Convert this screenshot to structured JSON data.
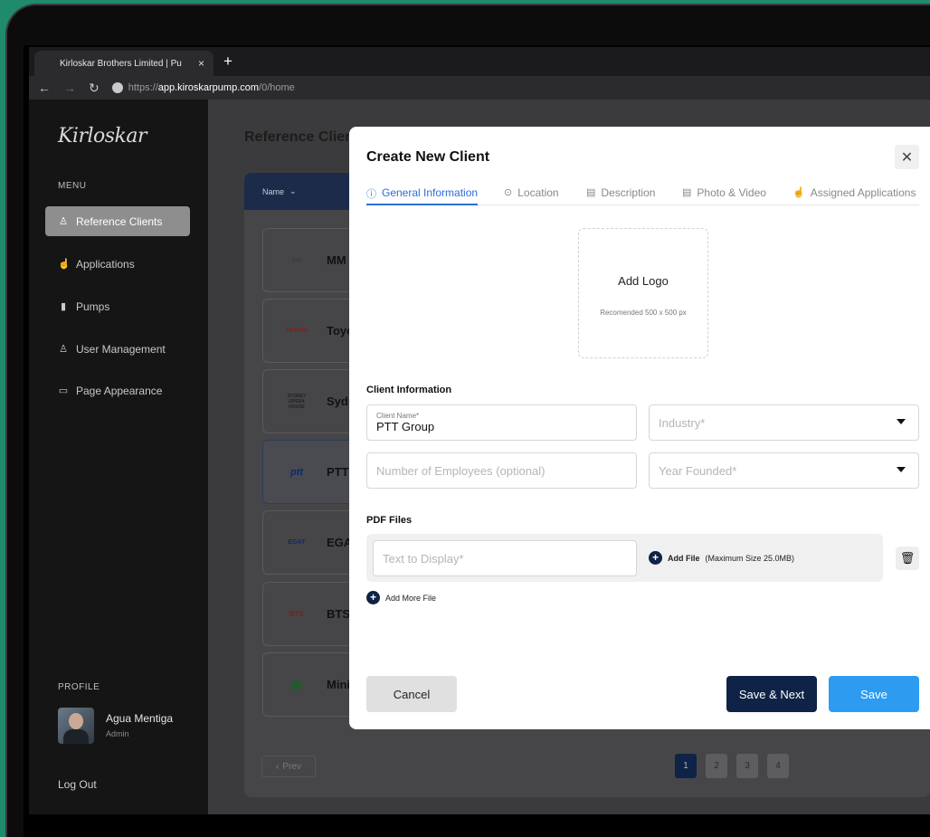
{
  "browser": {
    "tab_title": "Kirloskar Brothers Limited | Pu",
    "tab_close": "×",
    "new_tab": "+",
    "url_prefix": "https://",
    "url_host": "app.kiroskarpump.com",
    "url_path": "/0/home"
  },
  "sidebar": {
    "brand": "Kirloskar",
    "menu_label": "MENU",
    "items": [
      {
        "label": "Reference Clients",
        "icon": "user-icon",
        "active": true
      },
      {
        "label": "Applications",
        "icon": "hand-icon",
        "active": false
      },
      {
        "label": "Pumps",
        "icon": "pump-icon",
        "active": false
      },
      {
        "label": "User Management",
        "icon": "users-icon",
        "active": false
      },
      {
        "label": "Page Appearance",
        "icon": "monitor-icon",
        "active": false
      }
    ],
    "profile_label": "PROFILE",
    "user_name": "Agua Mentiga",
    "user_role": "Admin",
    "logout": "Log Out"
  },
  "main": {
    "page_title": "Reference Clien",
    "table_head": "Name",
    "clients": [
      {
        "name": "MM",
        "logo": "≡≡≡"
      },
      {
        "name": "Toyo",
        "logo": "TOYOTA"
      },
      {
        "name": "Sydr",
        "logo": "SYDNEY OPERA HOUSE"
      },
      {
        "name": "PTT",
        "logo": "ptt"
      },
      {
        "name": "EGA",
        "logo": "EGAT"
      },
      {
        "name": "BTS",
        "logo": "BTS"
      },
      {
        "name": "Mini",
        "logo": "◉"
      }
    ],
    "prev_label": "Prev",
    "pages": [
      "1",
      "2",
      "3",
      "4"
    ],
    "active_page": "1"
  },
  "modal": {
    "title": "Create New Client",
    "close": "✕",
    "tabs": [
      {
        "label": "General Information",
        "icon": "info-icon",
        "active": true
      },
      {
        "label": "Location",
        "icon": "location-icon",
        "active": false
      },
      {
        "label": "Description",
        "icon": "document-icon",
        "active": false
      },
      {
        "label": "Photo & Video",
        "icon": "photo-icon",
        "active": false
      },
      {
        "label": "Assigned Applications",
        "icon": "hand-icon",
        "active": false
      }
    ],
    "logo": {
      "title": "Add Logo",
      "hint": "Recomended 500 x 500 px"
    },
    "client_info_label": "Client Information",
    "client_name": {
      "label": "Client Name*",
      "value": "PTT Group"
    },
    "industry": {
      "placeholder": "Industry*"
    },
    "employees": {
      "placeholder": "Number of Employees (optional)"
    },
    "year_founded": {
      "placeholder": "Year Founded*"
    },
    "pdf_label": "PDF Files",
    "text_to_display": {
      "placeholder": "Text to Display*"
    },
    "add_file": "Add File",
    "add_file_hint": "(Maximum Size 25.0MB)",
    "add_more": "Add More File",
    "cancel": "Cancel",
    "save_next": "Save & Next",
    "save": "Save"
  }
}
